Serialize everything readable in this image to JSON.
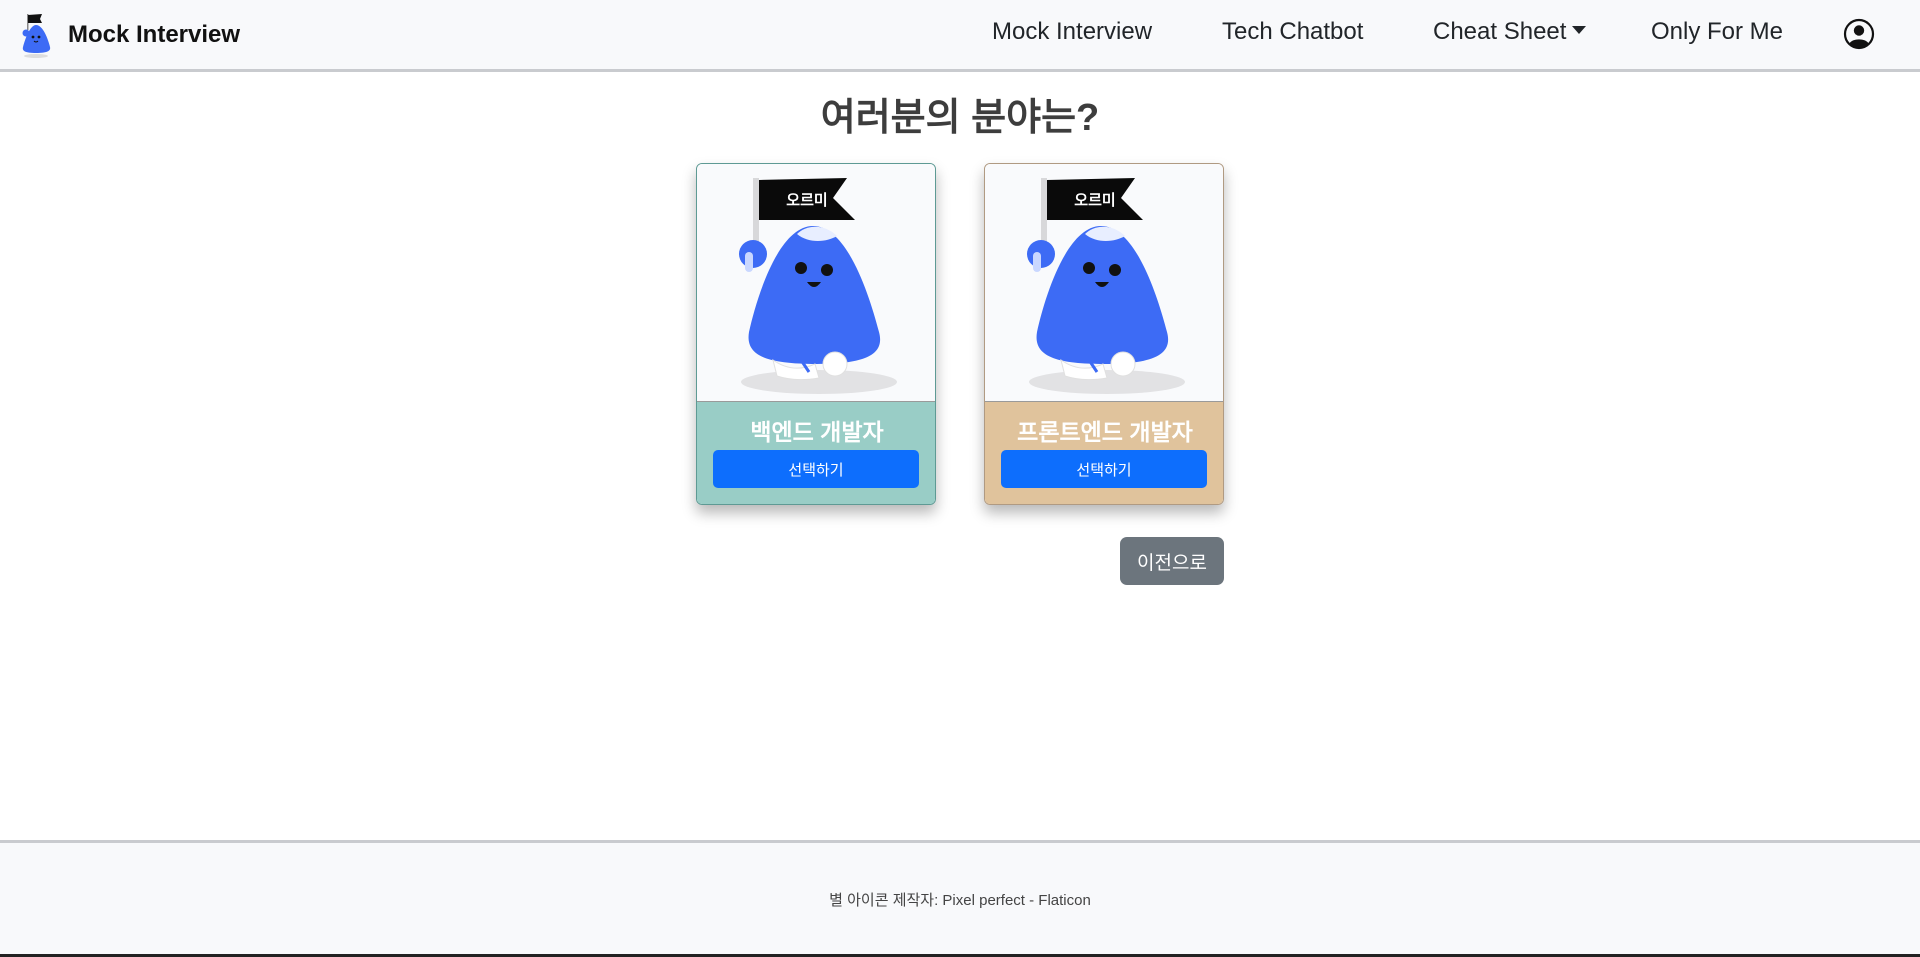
{
  "navbar": {
    "brand": "Mock Interview",
    "links": [
      "Mock Interview",
      "Tech Chatbot",
      "Cheat Sheet",
      "Only For Me"
    ],
    "user_icon": "user-circle-icon"
  },
  "main": {
    "heading": "여러분의 분야는?",
    "cards": [
      {
        "flag_text": "오르미",
        "title": "백엔드 개발자",
        "button": "선택하기",
        "color": "#99cdc6"
      },
      {
        "flag_text": "오르미",
        "title": "프론트엔드 개발자",
        "button": "선택하기",
        "color": "#e0c39c"
      }
    ],
    "back_button": "이전으로"
  },
  "footer": {
    "credit": "별 아이콘 제작자: Pixel perfect - Flaticon"
  },
  "colors": {
    "primary": "#0d6efd",
    "secondary": "#6c757d",
    "mascot": "#3d6bf5"
  }
}
